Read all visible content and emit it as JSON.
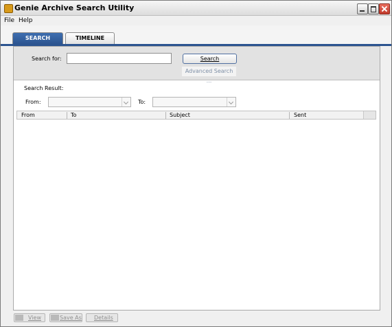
{
  "window": {
    "title": "Genie Archive Search Utility"
  },
  "menu": [
    "File",
    "Help"
  ],
  "tabs": [
    {
      "label": "SEARCH",
      "active": true
    },
    {
      "label": "TIMELINE",
      "active": false
    }
  ],
  "search": {
    "label": "Search for:",
    "value": "",
    "button_label": "Search",
    "advanced_label": "Advanced Search ..."
  },
  "result": {
    "label": "Search Result:",
    "from_label": "From:",
    "to_label": "To:",
    "from_value": "",
    "to_value": "",
    "columns": [
      "From",
      "To",
      "Subject",
      "Sent"
    ]
  },
  "footer": {
    "view": "View",
    "save_as": "Save As",
    "details": "Details"
  },
  "colors": {
    "accent": "#2c5490",
    "tab_active": "#3e6fb0"
  }
}
